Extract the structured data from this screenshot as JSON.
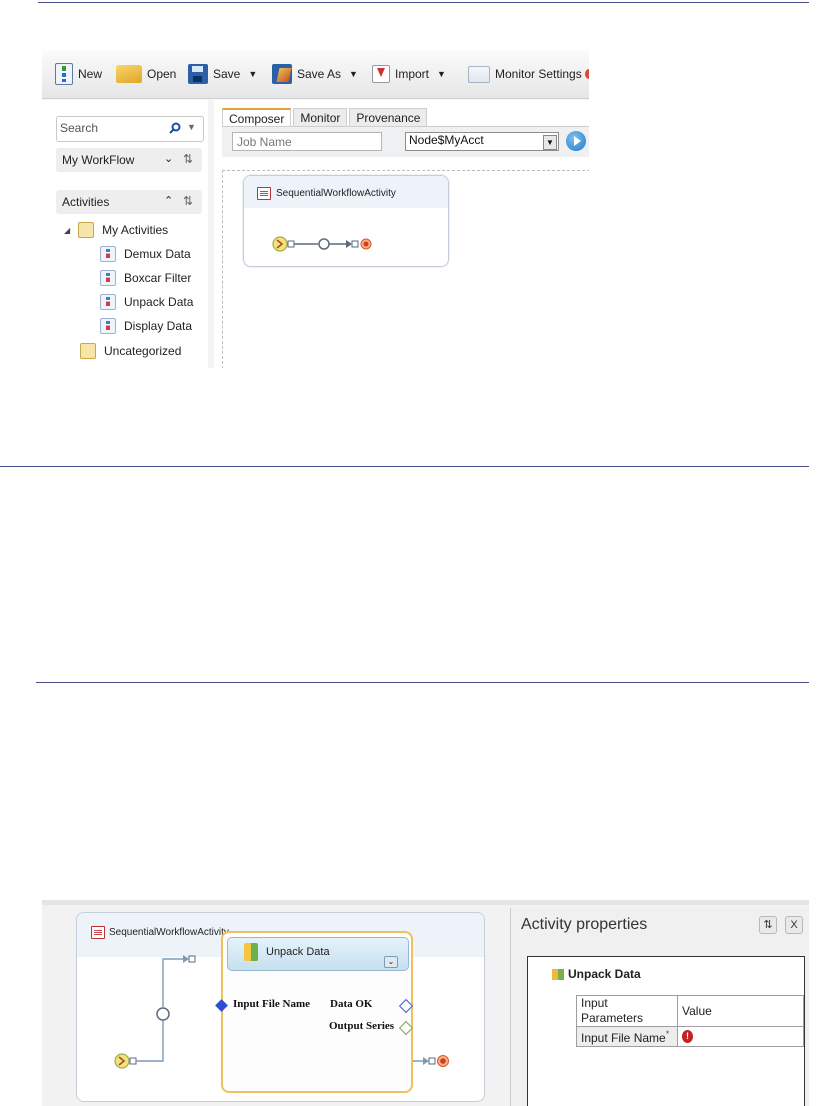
{
  "toolbar": {
    "new_label": "New",
    "open_label": "Open",
    "save_label": "Save",
    "save_as_label": "Save As",
    "import_label": "Import",
    "monitor_settings_label": "Monitor Settings",
    "caret": "▼"
  },
  "left_panel": {
    "search_placeholder": "Search",
    "workflow_label": "My WorkFlow",
    "activities_label": "Activities",
    "tree": {
      "root_label": "My Activities",
      "items": [
        {
          "label": "Demux Data"
        },
        {
          "label": "Boxcar Filter"
        },
        {
          "label": "Unpack Data"
        },
        {
          "label": "Display Data"
        }
      ],
      "uncategorized_label": "Uncategorized"
    }
  },
  "tabs": [
    {
      "label": "Composer",
      "active": true
    },
    {
      "label": "Monitor",
      "active": false
    },
    {
      "label": "Provenance",
      "active": false
    }
  ],
  "job": {
    "job_name_placeholder": "Job Name",
    "node_account_value": "Node$MyAcct"
  },
  "canvas": {
    "sequence_title": "SequentialWorkflowActivity"
  },
  "detail": {
    "sequence_title": "SequentialWorkflowActivity",
    "activity": {
      "title": "Unpack Data",
      "input_port": "Input File Name",
      "output_ports": [
        "Data OK",
        "Output Series"
      ]
    }
  },
  "properties": {
    "title": "Activity properties",
    "close_glyph": "X",
    "tree_root": "Unpack Data",
    "table_headers": [
      "Input Parameters",
      "Value"
    ],
    "rows": [
      {
        "name": "Input File Name",
        "required_mark": "*",
        "value": ""
      }
    ]
  },
  "colors": {
    "rule": "#4a4f86",
    "accent_orange": "#e3a33a",
    "run_blue": "#1e78c8",
    "error_red": "#c62020"
  }
}
